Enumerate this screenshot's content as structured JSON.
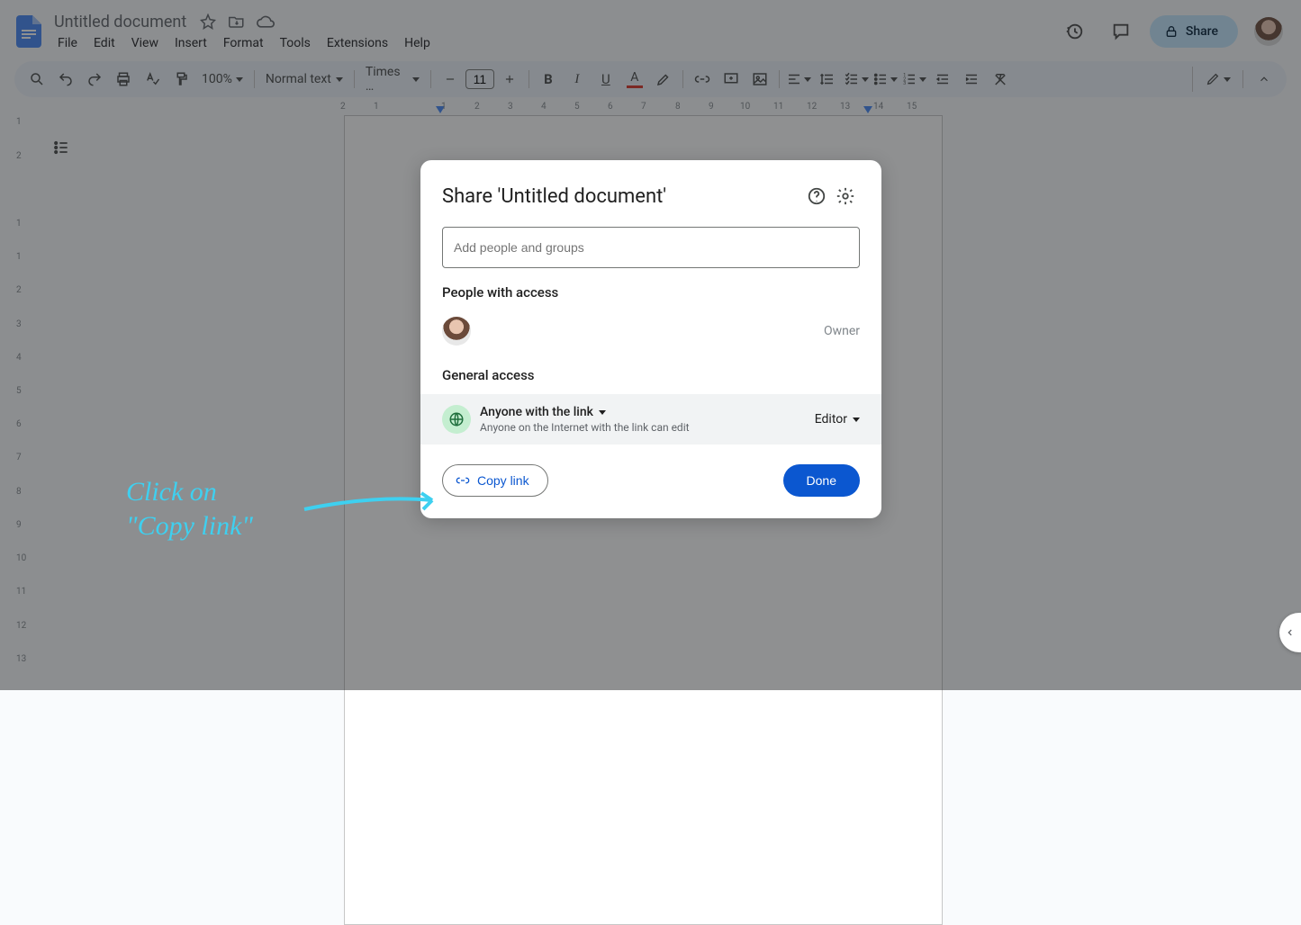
{
  "header": {
    "doc_title": "Untitled document",
    "menus": [
      "File",
      "Edit",
      "View",
      "Insert",
      "Format",
      "Tools",
      "Extensions",
      "Help"
    ],
    "share_label": "Share"
  },
  "toolbar": {
    "zoom": "100%",
    "style": "Normal text",
    "font": "Times …",
    "font_size": "11"
  },
  "ruler_h": [
    "2",
    "1",
    "1",
    "2",
    "3",
    "4",
    "5",
    "6",
    "7",
    "8",
    "9",
    "10",
    "11",
    "12",
    "13",
    "14",
    "15"
  ],
  "ruler_v": [
    "1",
    "2",
    "1",
    "1",
    "2",
    "3",
    "4",
    "5",
    "6",
    "7",
    "8",
    "9",
    "10",
    "11",
    "12",
    "13"
  ],
  "share_dialog": {
    "title": "Share 'Untitled document'",
    "input_placeholder": "Add people and groups",
    "people_section": "People with access",
    "owner_role": "Owner",
    "general_section": "General access",
    "access_title": "Anyone with the link",
    "access_sub": "Anyone on the Internet with the link can edit",
    "role": "Editor",
    "copy_link": "Copy link",
    "done": "Done"
  },
  "annotation": {
    "line1": "Click on",
    "line2": "\"Copy link\""
  }
}
